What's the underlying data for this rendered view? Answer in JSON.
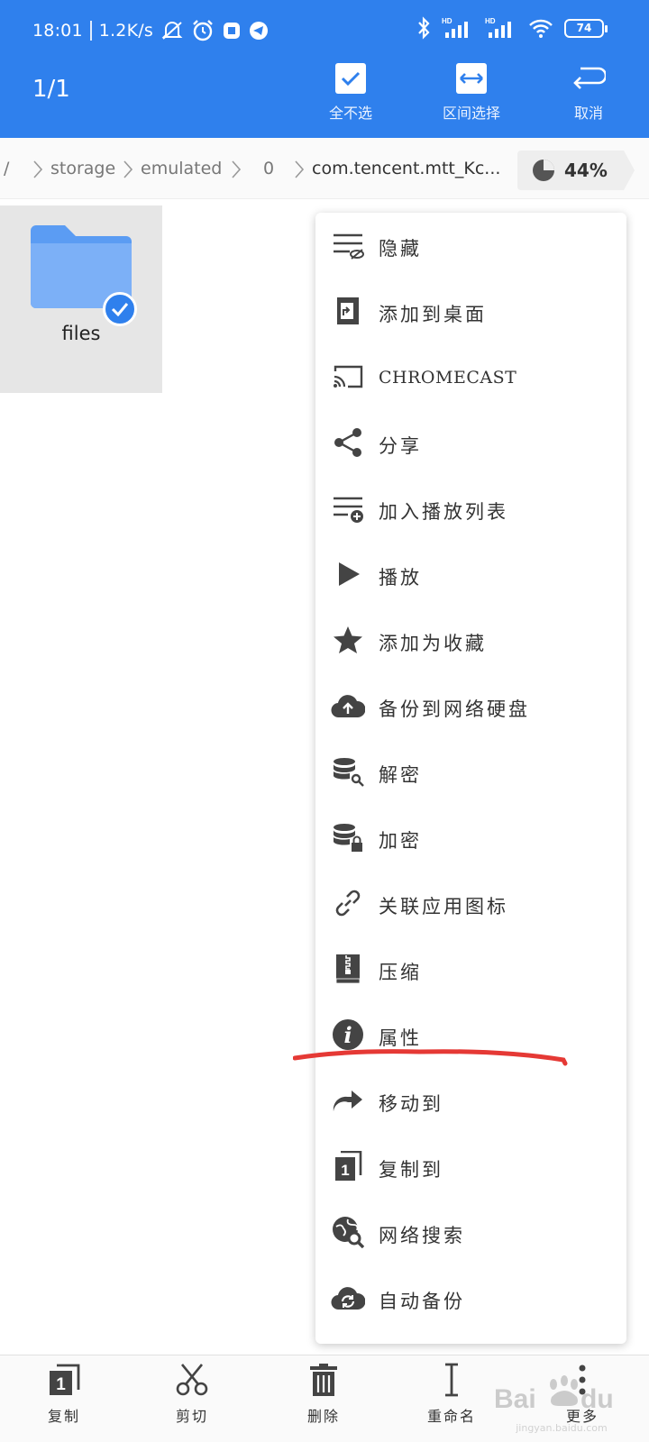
{
  "status_bar": {
    "time": "18:01",
    "net_speed": "1.2K/s",
    "battery": "74",
    "signal_tags": [
      "HD",
      "HD"
    ]
  },
  "app_bar": {
    "selection_count": "1/1",
    "actions": [
      {
        "label": "全不选",
        "icon": "checkbox-icon"
      },
      {
        "label": "区间选择",
        "icon": "range-select-icon"
      },
      {
        "label": "取消",
        "icon": "undo-icon"
      }
    ],
    "background_color": "#2f80ed"
  },
  "breadcrumb": {
    "items": [
      "/",
      "storage",
      "emulated",
      "0",
      "com.tencent.mtt_Kc..."
    ],
    "storage_usage": "44%"
  },
  "files": [
    {
      "name": "files",
      "icon": "folder-icon",
      "selected": true
    }
  ],
  "menu": {
    "items": [
      {
        "label": "隐藏",
        "icon": "hide-list-icon"
      },
      {
        "label": "添加到桌面",
        "icon": "add-to-desktop-icon"
      },
      {
        "label": "CHROMECAST",
        "icon": "cast-icon"
      },
      {
        "label": "分享",
        "icon": "share-icon"
      },
      {
        "label": "加入播放列表",
        "icon": "playlist-add-icon"
      },
      {
        "label": "播放",
        "icon": "play-icon"
      },
      {
        "label": "添加为收藏",
        "icon": "star-icon"
      },
      {
        "label": "备份到网络硬盘",
        "icon": "cloud-upload-icon"
      },
      {
        "label": "解密",
        "icon": "decrypt-icon"
      },
      {
        "label": "加密",
        "icon": "encrypt-icon"
      },
      {
        "label": "关联应用图标",
        "icon": "link-icon"
      },
      {
        "label": "压缩",
        "icon": "archive-icon"
      },
      {
        "label": "属性",
        "icon": "info-icon"
      },
      {
        "label": "移动到",
        "icon": "move-icon"
      },
      {
        "label": "复制到",
        "icon": "copy-to-icon"
      },
      {
        "label": "网络搜索",
        "icon": "web-search-icon"
      },
      {
        "label": "自动备份",
        "icon": "auto-backup-icon"
      }
    ],
    "highlight_color": "#e53935"
  },
  "bottom_bar": {
    "buttons": [
      {
        "label": "复制",
        "icon": "copy-icon"
      },
      {
        "label": "剪切",
        "icon": "cut-icon"
      },
      {
        "label": "删除",
        "icon": "delete-icon"
      },
      {
        "label": "重命名",
        "icon": "rename-icon"
      },
      {
        "label": "更多",
        "icon": "more-vert-icon"
      }
    ]
  },
  "watermark": {
    "text": "Baidu 经验",
    "url_text": "jingyan.baidu.com"
  }
}
